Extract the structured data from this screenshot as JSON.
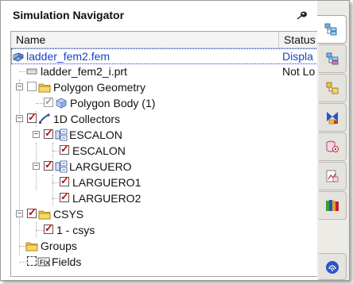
{
  "navigator": {
    "title": "Simulation Navigator",
    "columns": {
      "name": "Name",
      "status": "Status"
    },
    "rows": [
      {
        "label": "ladder_fem2.fem",
        "status": "Displa",
        "icon": "fem-mesh-icon"
      },
      {
        "label": "ladder_fem2_i.prt",
        "status": "Not Lo",
        "icon": "part-file-icon"
      },
      {
        "label": "Polygon Geometry",
        "icon": "folder-icon"
      },
      {
        "label": "Polygon Body (1)",
        "icon": "polygon-body-icon"
      },
      {
        "label": "1D Collectors",
        "icon": "1d-collector-icon"
      },
      {
        "label": "ESCALON",
        "icon": "mesh-collector-icon"
      },
      {
        "label": "ESCALON",
        "icon": "mesh-icon"
      },
      {
        "label": "LARGUERO",
        "icon": "mesh-collector-icon"
      },
      {
        "label": "LARGUERO1",
        "icon": "mesh-icon"
      },
      {
        "label": "LARGUERO2",
        "icon": "mesh-icon"
      },
      {
        "label": "CSYS",
        "icon": "folder-icon"
      },
      {
        "label": "1 - csys",
        "icon": "csys-icon"
      },
      {
        "label": "Groups",
        "icon": "folder-icon"
      },
      {
        "label": "Fields",
        "icon": "fields-icon"
      }
    ]
  },
  "rail_tabs": [
    "simulation-navigator-icon",
    "sim-file-view-icon",
    "part-navigator-icon",
    "constraints-navigator-icon",
    "reuse-library-icon",
    "history-icon",
    "palette-icon",
    "info-icon"
  ],
  "colors": {
    "selection_text": "#1a3fc8",
    "check": "#d00000",
    "folder": "#f0c23a"
  }
}
